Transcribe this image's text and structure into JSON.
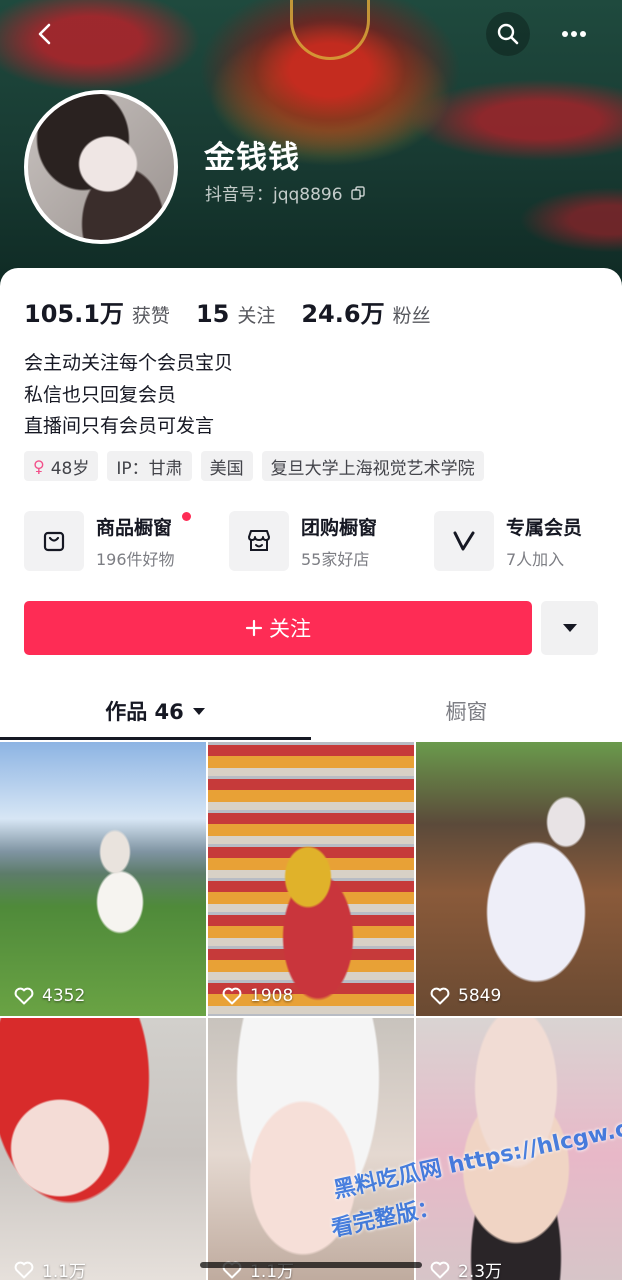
{
  "header": {
    "nickname": "金钱钱",
    "douyin_id": "抖音号：jqq8896"
  },
  "stats": [
    {
      "value": "105.1万",
      "label": "获赞"
    },
    {
      "value": "15",
      "label": "关注"
    },
    {
      "value": "24.6万",
      "label": "粉丝"
    }
  ],
  "bio": [
    "会主动关注每个会员宝贝",
    "私信也只回复会员",
    "直播间只有会员可发言"
  ],
  "tags": [
    "48岁",
    "IP：甘肃",
    "美国",
    "复旦大学上海视觉艺术学院"
  ],
  "features": [
    {
      "title": "商品橱窗",
      "subtitle": "196件好物",
      "icon": "bag-icon"
    },
    {
      "title": "团购橱窗",
      "subtitle": "55家好店",
      "icon": "store-icon"
    },
    {
      "title": "专属会员",
      "subtitle": "7人加入",
      "icon": "v-icon"
    }
  ],
  "actions": {
    "follow_label": "关注"
  },
  "tabs": [
    {
      "label": "作品 46"
    },
    {
      "label": "橱窗"
    }
  ],
  "posts": [
    {
      "likes": "4352"
    },
    {
      "likes": "1908"
    },
    {
      "likes": "5849"
    },
    {
      "likes": "1.1万"
    },
    {
      "likes": "1.1万"
    },
    {
      "likes": "2.3万"
    }
  ],
  "watermark": {
    "line1": "黑料吃瓜网 https://hlcgw.co",
    "line2": "看完整版："
  },
  "colors": {
    "accent": "#fe2c55",
    "tag_bg": "#f1f1f2"
  }
}
